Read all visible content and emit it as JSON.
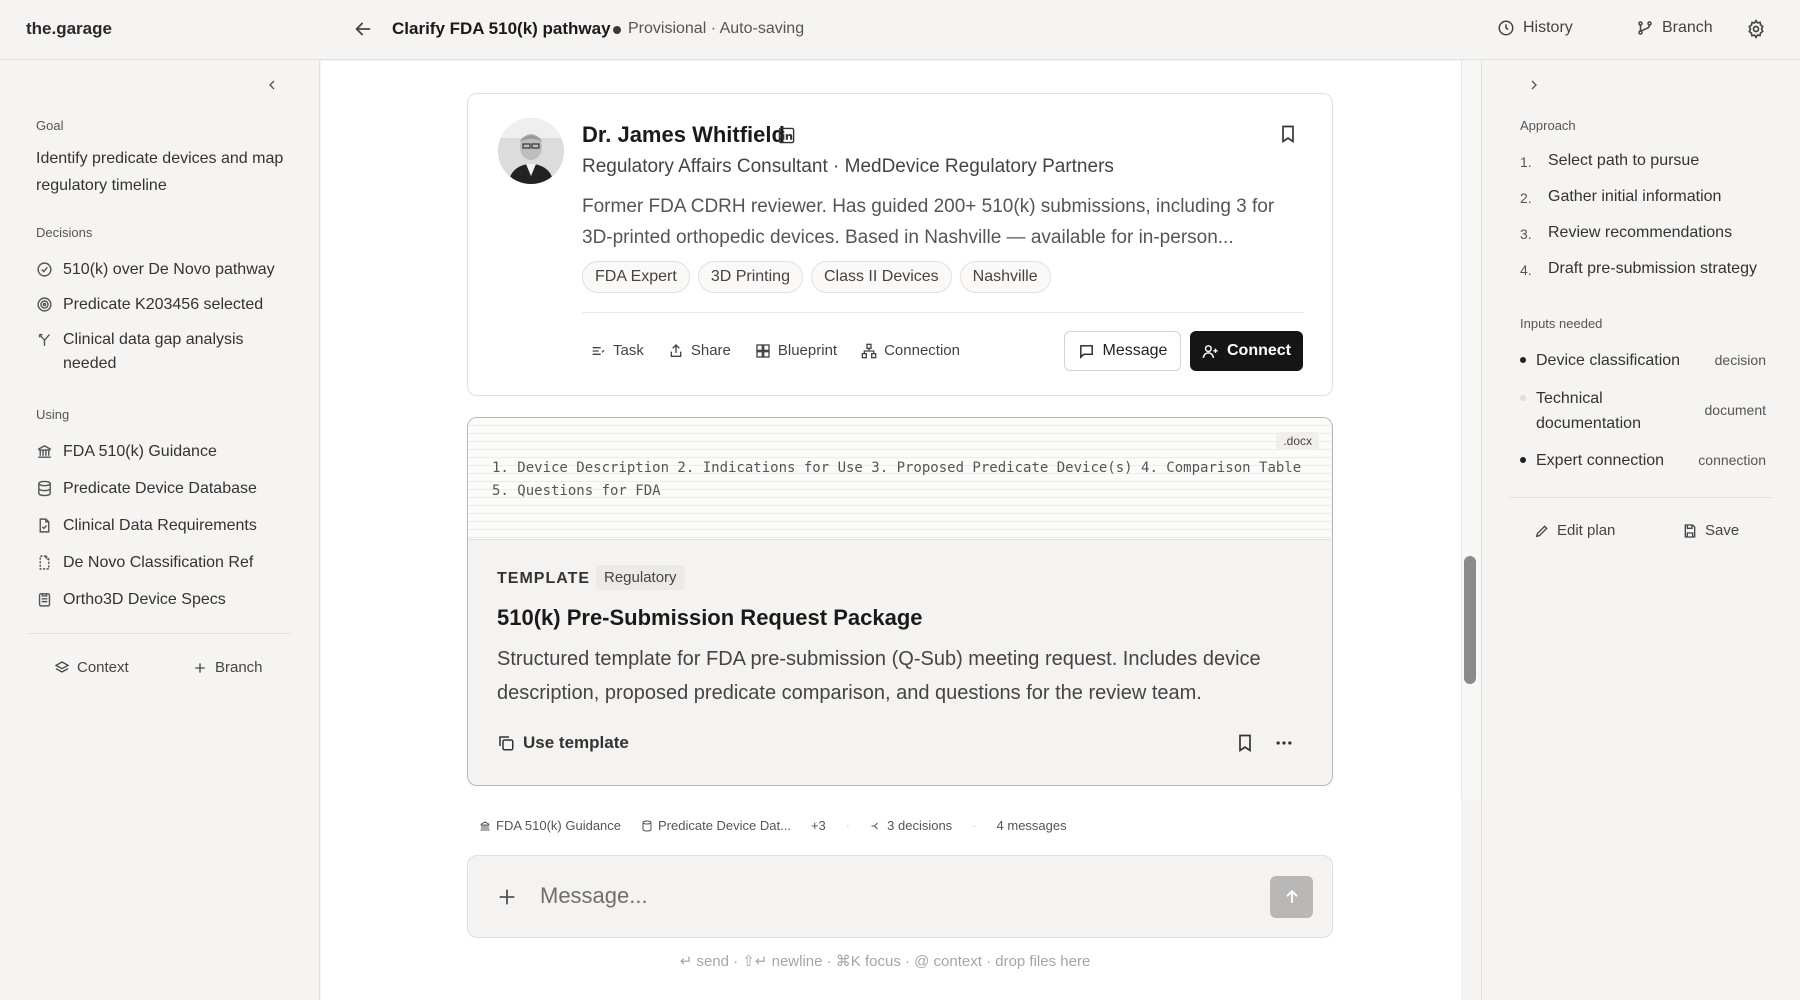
{
  "app": {
    "brand": "the.garage"
  },
  "header": {
    "title": "Clarify FDA 510(k) pathway",
    "status": "Provisional · Auto-saving",
    "history_label": "History",
    "branch_label": "Branch"
  },
  "left": {
    "goal_label": "Goal",
    "goal_text": "Identify predicate devices and map regulatory timeline",
    "decisions_label": "Decisions",
    "decisions": [
      "510(k) over De Novo pathway",
      "Predicate K203456 selected",
      "Clinical data gap analysis needed"
    ],
    "using_label": "Using",
    "using": [
      "FDA 510(k) Guidance",
      "Predicate Device Database",
      "Clinical Data Requirements",
      "De Novo Classification Ref",
      "Ortho3D Device Specs"
    ],
    "context_label": "Context",
    "branch_label": "Branch"
  },
  "profile": {
    "name": "Dr. James Whitfield",
    "role": "Regulatory Affairs Consultant · MedDevice Regulatory Partners",
    "bio": "Former FDA CDRH reviewer. Has guided 200+ 510(k) submissions, including 3 for 3D-printed orthopedic devices. Based in Nashville — available for in-person...",
    "tags": [
      "FDA Expert",
      "3D Printing",
      "Class II Devices",
      "Nashville"
    ],
    "actions": [
      "Task",
      "Share",
      "Blueprint",
      "Connection"
    ],
    "message_label": "Message",
    "connect_label": "Connect"
  },
  "template": {
    "preview_text": "1. Device Description 2. Indications for Use 3. Proposed Predicate Device(s) 4. Comparison Table 5. Questions for FDA",
    "file_ext": ".docx",
    "kind": "TEMPLATE",
    "category": "Regulatory",
    "title": "510(k) Pre-Submission Request Package",
    "description": "Structured template for FDA pre-submission (Q-Sub) meeting request. Includes device description, proposed predicate comparison, and questions for the review team.",
    "use_label": "Use template"
  },
  "context_bar": {
    "sources": [
      "FDA 510(k) Guidance",
      "Predicate Device Dat..."
    ],
    "more": "+3",
    "decisions": "3 decisions",
    "messages": "4 messages"
  },
  "composer": {
    "placeholder": "Message...",
    "hint": "↵ send · ⇧↵ newline · ⌘K focus · @ context · drop files here"
  },
  "right": {
    "approach_label": "Approach",
    "steps": [
      {
        "num": "1.",
        "label": "Select path to pursue"
      },
      {
        "num": "2.",
        "label": "Gather initial information"
      },
      {
        "num": "3.",
        "label": "Review recommendations"
      },
      {
        "num": "4.",
        "label": "Draft pre-submission strategy"
      }
    ],
    "inputs_label": "Inputs needed",
    "inputs": [
      {
        "name": "Device classification",
        "kind": "decision"
      },
      {
        "name": "Technical documentation",
        "kind": "document"
      },
      {
        "name": "Expert connection",
        "kind": "connection"
      }
    ],
    "edit_label": "Edit plan",
    "save_label": "Save"
  }
}
